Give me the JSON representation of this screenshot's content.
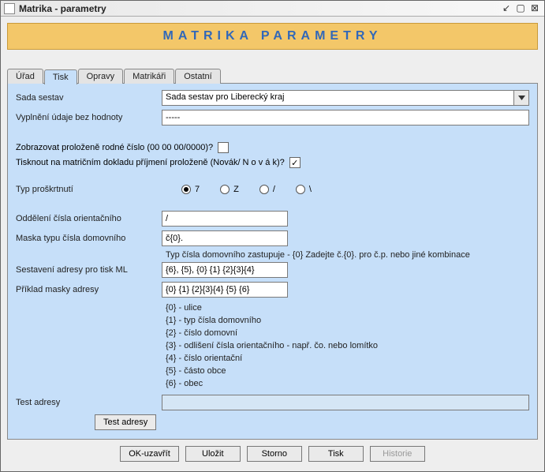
{
  "window": {
    "title": "Matrika - parametry"
  },
  "header": {
    "title": "MATRIKA PARAMETRY"
  },
  "tabs": {
    "urad": "Úřad",
    "tisk": "Tisk",
    "opravy": "Opravy",
    "matrikari": "Matrikáři",
    "ostatni": "Ostatní"
  },
  "form": {
    "sada_label": "Sada sestav",
    "sada_value": "Sada sestav pro Liberecký kraj",
    "vyplneni_label": "Vyplnění údaje bez hodnoty",
    "vyplneni_value": "-----",
    "prolozene_rodne_label": "Zobrazovat proloženě rodné číslo (00 00 00/0000)?",
    "prijmeni_prolozene_label": "Tisknout na matričním dokladu příjmení proloženě (Novák/ N o v á k)?",
    "typ_proskrtnuti_label": "Typ proškrtnutí",
    "radios": {
      "r1": "7",
      "r2": "Z",
      "r3": "/",
      "r4": "\\"
    },
    "oddeleni_label": "Oddělení čísla orientačního",
    "oddeleni_value": "/",
    "maska_label": "Maska typu čísla domovního",
    "maska_value": "č{0}.",
    "maska_hint": "Typ čísla domovního zastupuje - {0} Zadejte č.{0}. pro č.p. nebo jiné kombinace",
    "sestaveni_label": "Sestavení adresy pro tisk ML",
    "sestaveni_value": "{6}, {5}, {0} {1} {2}{3}{4}",
    "priklad_label": "Příklad masky adresy",
    "priklad_value": "{0} {1} {2}{3}{4} {5} {6}",
    "legend": {
      "l0": "{0} - ulice",
      "l1": "{1} - typ čísla domovního",
      "l2": "{2} - číslo domovní",
      "l3": "{3} - odlišení čísla orientačního - např. čo. nebo lomítko",
      "l4": "{4} - číslo orientační",
      "l5": "{5} - částo obce",
      "l6": "{6} - obec"
    },
    "test_label": "Test adresy",
    "test_value": "",
    "test_button": "Test adresy"
  },
  "buttons": {
    "ok": "OK-uzavřít",
    "save": "Uložit",
    "cancel": "Storno",
    "print": "Tisk",
    "history": "Historie"
  }
}
